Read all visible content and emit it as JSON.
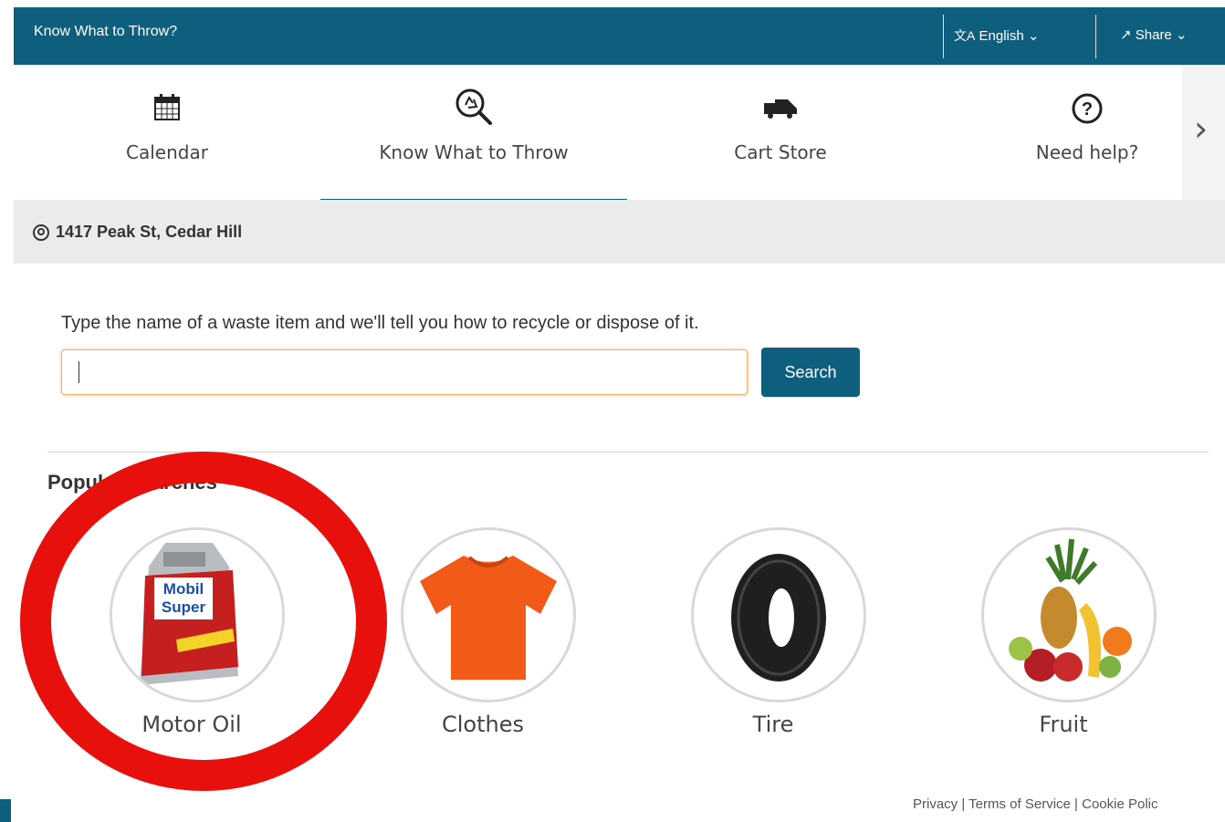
{
  "topbar": {
    "title": "Know What to Throw?",
    "language": "English",
    "share": "Share",
    "background_color": "#0e5e7e"
  },
  "nav": {
    "tabs": [
      {
        "label": "Calendar",
        "icon": "calendar-icon"
      },
      {
        "label": "Know What to Throw",
        "icon": "recycle-search-icon",
        "active": true
      },
      {
        "label": "Cart Store",
        "icon": "garbage-truck-icon"
      },
      {
        "label": "Need help?",
        "icon": "question-circle-icon"
      }
    ],
    "more_icon": "chevron-right-icon"
  },
  "address": {
    "text": "1417 Peak St, Cedar Hill",
    "icon": "location-pin-icon"
  },
  "search": {
    "prompt": "Type the name of a waste item and we'll tell you how to recycle or dispose of it.",
    "value": "",
    "button_label": "Search"
  },
  "popular": {
    "title": "Popular Searches",
    "items": [
      {
        "label": "Motor Oil",
        "image": "motor-oil-bottle"
      },
      {
        "label": "Clothes",
        "image": "orange-t-shirt"
      },
      {
        "label": "Tire",
        "image": "tire"
      },
      {
        "label": "Fruit",
        "image": "fruit-bundle"
      }
    ]
  },
  "oil_bottle_text": [
    "Mobil",
    "Super"
  ],
  "annotation": {
    "shape": "red-circle",
    "color": "#e8100d",
    "target": "Motor Oil"
  },
  "footer": {
    "privacy": "Privacy",
    "terms": "Terms of Service",
    "cookie": "Cookie Polic",
    "separator": "|"
  }
}
